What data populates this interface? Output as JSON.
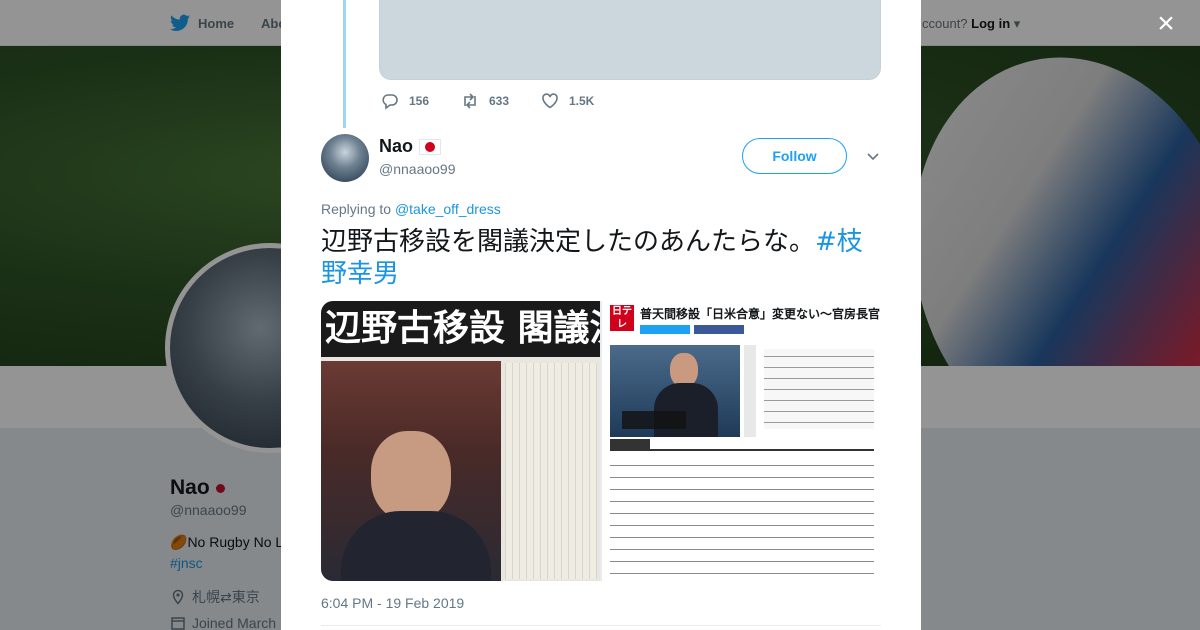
{
  "background_page": {
    "nav": {
      "home_label": "Home",
      "about_label": "Abo",
      "account_prompt": "ccount?",
      "login_label": "Log in"
    },
    "profile": {
      "name": "Nao",
      "handle": "@nnaaoo99",
      "bio": "No Rugby No L",
      "hashtag": "#jnsc",
      "location": "札幌⇄東京",
      "joined": "Joined March"
    }
  },
  "modal": {
    "close_label": "×",
    "previous_tweet": {
      "actions": {
        "replies": "156",
        "retweets": "633",
        "likes": "1.5K"
      }
    },
    "tweet": {
      "display_name": "Nao",
      "handle": "@nnaaoo99",
      "follow_label": "Follow",
      "replying_prefix": "Replying to",
      "replying_to": "@take_off_dress",
      "text": "辺野古移設を閣議決定したのあんたらな。",
      "hashtag": "#枝野幸男",
      "timestamp": "6:04 PM - 19 Feb 2019",
      "media": [
        {
          "headline": "辺野古移設 閣議決"
        },
        {
          "logo": "日テレ NEWS 24",
          "headline": "普天間移設「日米合意」変更ない～官房長官"
        }
      ]
    }
  },
  "colors": {
    "twitter_blue": "#1da1f2",
    "link_blue": "#1b95e0",
    "muted": "#657786",
    "flag_red": "#d0021b"
  }
}
